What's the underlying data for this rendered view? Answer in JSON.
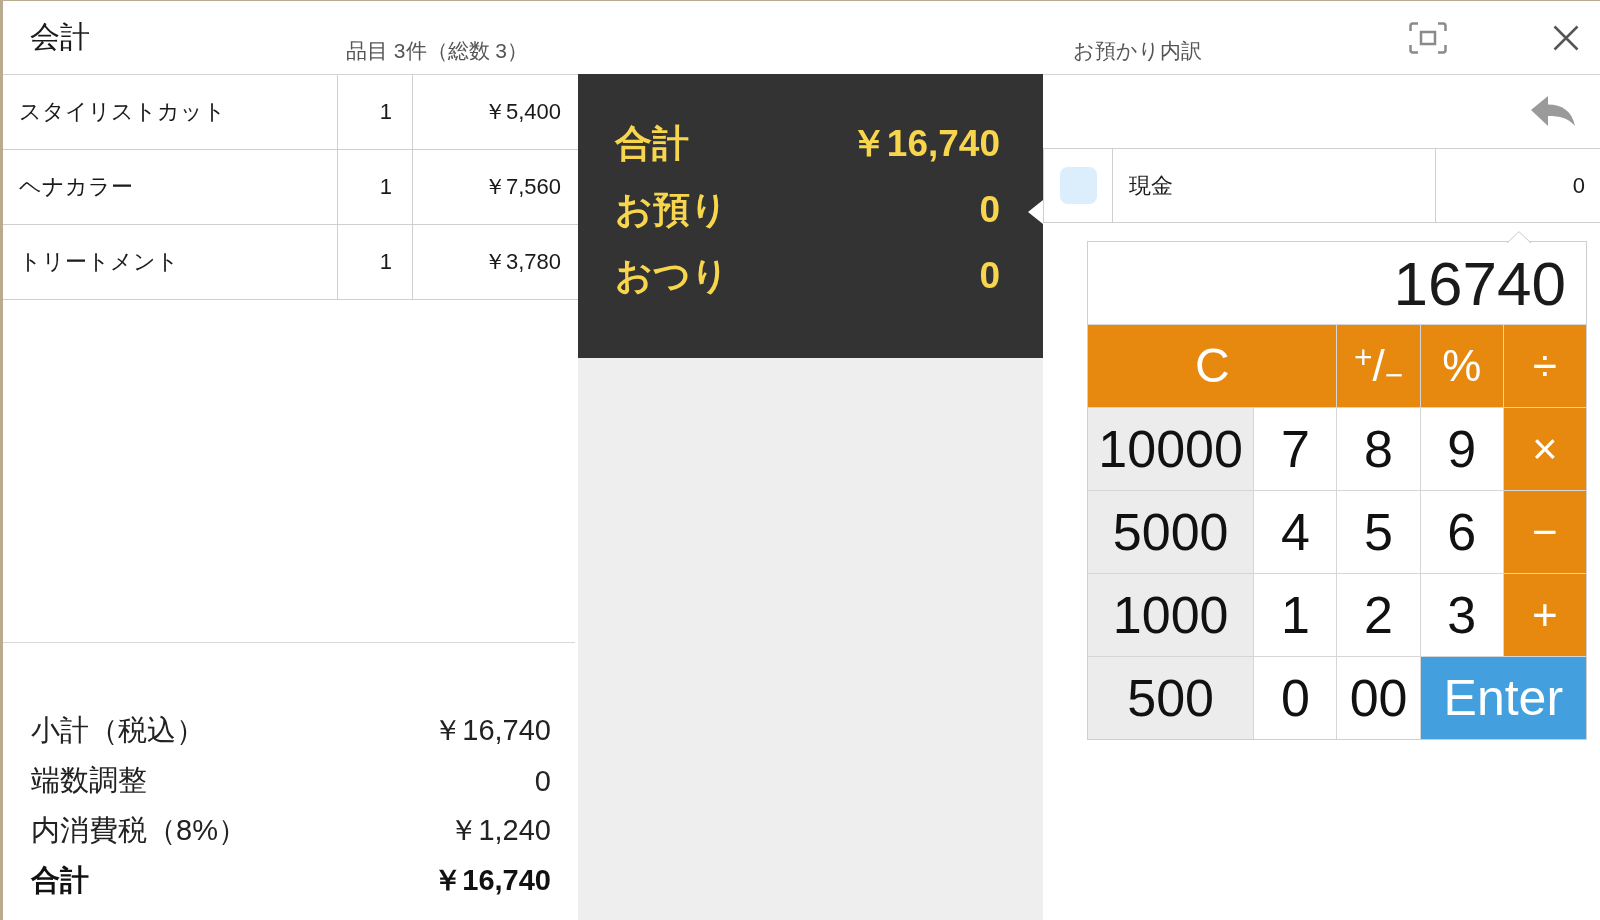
{
  "window": {
    "title": "会計"
  },
  "items_summary": "品目 3件（総数 3）",
  "items": [
    {
      "name": "スタイリストカット",
      "quantity": "1",
      "price": "￥5,400"
    },
    {
      "name": "ヘナカラー",
      "quantity": "1",
      "price": "￥7,560"
    },
    {
      "name": "トリートメント",
      "quantity": "1",
      "price": "￥3,780"
    }
  ],
  "totals": [
    {
      "label": "小計（税込）",
      "value": "￥16,740",
      "emphasis": false
    },
    {
      "label": "端数調整",
      "value": "0",
      "emphasis": false
    },
    {
      "label": "内消費税（8%）",
      "value": "￥1,240",
      "emphasis": false
    },
    {
      "label": "合計",
      "value": "￥16,740",
      "emphasis": true
    }
  ],
  "summary": [
    {
      "label": "合計",
      "value": "￥16,740"
    },
    {
      "label": "お預り",
      "value": "0"
    },
    {
      "label": "おつり",
      "value": "0"
    }
  ],
  "payments": {
    "heading": "お預かり内訳",
    "rows": [
      {
        "method": "現金",
        "amount": "0",
        "selected": true
      }
    ]
  },
  "calculator": {
    "display": "16740",
    "keys": [
      {
        "label": "C",
        "kind": "clear"
      },
      {
        "label": "$^{+}$/$_{−}$",
        "kind": "operator"
      },
      {
        "label": "%",
        "kind": "operator"
      },
      {
        "label": "÷",
        "kind": "operator"
      },
      {
        "label": "10000",
        "kind": "denomination"
      },
      {
        "label": "7",
        "kind": "digit"
      },
      {
        "label": "8",
        "kind": "digit"
      },
      {
        "label": "9",
        "kind": "digit"
      },
      {
        "label": "×",
        "kind": "operator"
      },
      {
        "label": "5000",
        "kind": "denomination"
      },
      {
        "label": "4",
        "kind": "digit"
      },
      {
        "label": "5",
        "kind": "digit"
      },
      {
        "label": "6",
        "kind": "digit"
      },
      {
        "label": "−",
        "kind": "operator"
      },
      {
        "label": "1000",
        "kind": "denomination"
      },
      {
        "label": "1",
        "kind": "digit"
      },
      {
        "label": "2",
        "kind": "digit"
      },
      {
        "label": "3",
        "kind": "digit"
      },
      {
        "label": "+",
        "kind": "operator"
      },
      {
        "label": "500",
        "kind": "denomination"
      },
      {
        "label": "0",
        "kind": "digit"
      },
      {
        "label": "00",
        "kind": "digit"
      },
      {
        "label": "Enter",
        "kind": "enter"
      }
    ]
  }
}
